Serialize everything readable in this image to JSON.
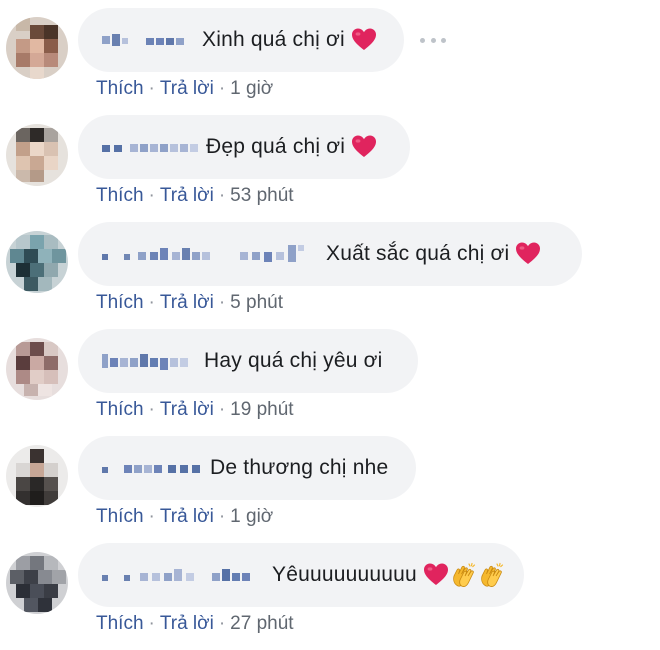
{
  "colors": {
    "link": "#385898",
    "time": "#606770",
    "bubble": "#f2f3f5",
    "heart": "#e0245e"
  },
  "labels": {
    "like": "Thích",
    "reply": "Trả lời",
    "separator": "·"
  },
  "comments": [
    {
      "text": "Xinh quá chị ơi",
      "emojis": [
        "red-heart"
      ],
      "time": "1 giờ"
    },
    {
      "text": "Đẹp quá chị ơi",
      "emojis": [
        "red-heart"
      ],
      "time": "53 phút"
    },
    {
      "text": "Xuất sắc quá chị ơi",
      "emojis": [
        "red-heart"
      ],
      "time": "5 phút"
    },
    {
      "text": "Hay quá chị yêu ơi",
      "emojis": [],
      "time": "19 phút"
    },
    {
      "text": "De thương chị nhe",
      "emojis": [],
      "time": "1 giờ"
    },
    {
      "text": "Yêuuuuuuuuuu",
      "emojis": [
        "red-heart",
        "clapping-hands",
        "clapping-hands"
      ],
      "time": "27 phút"
    }
  ]
}
